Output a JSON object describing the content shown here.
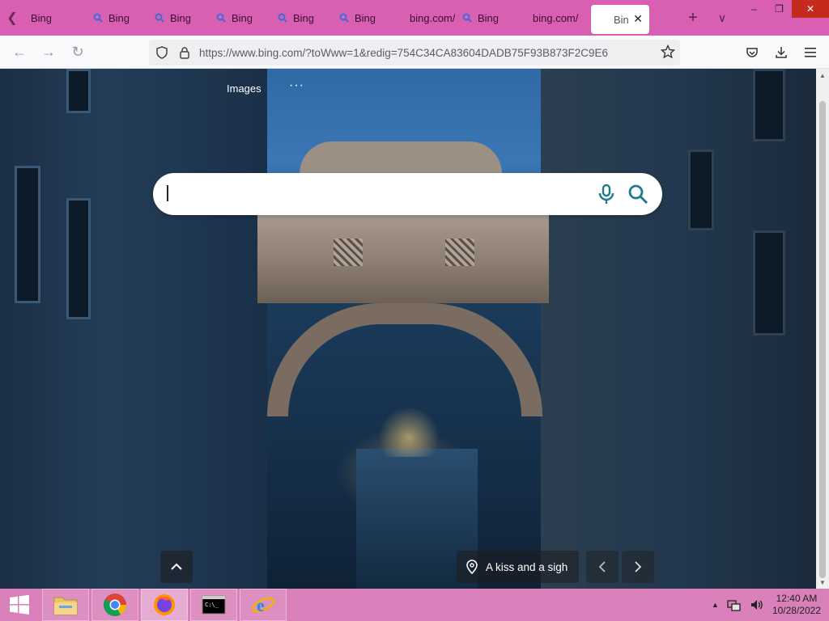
{
  "browser": {
    "tabs": [
      {
        "label": "Bing",
        "icon": "search-icon"
      },
      {
        "label": "Bing",
        "icon": "search-icon"
      },
      {
        "label": "Bing",
        "icon": "search-icon"
      },
      {
        "label": "Bing",
        "icon": "search-icon"
      },
      {
        "label": "Bing",
        "icon": "search-icon"
      },
      {
        "label": "Bing",
        "icon": "search-icon"
      },
      {
        "label": "bing.com/",
        "icon": ""
      },
      {
        "label": "Bing",
        "icon": "search-icon"
      },
      {
        "label": "bing.com/",
        "icon": ""
      },
      {
        "label": "Bin",
        "icon": "",
        "active": true
      }
    ],
    "url": "https://www.bing.com/?toWww=1&redig=754C34CA83604DADB75F93B873F2C9E6"
  },
  "bing": {
    "header_link": "Images",
    "more": "···",
    "search_value": "",
    "caption": "A kiss and a sigh"
  },
  "taskbar": {
    "apps": [
      "file-explorer",
      "chrome",
      "firefox",
      "command-prompt",
      "internet-explorer"
    ],
    "time": "12:40 AM",
    "date": "10/28/2022"
  },
  "colors": {
    "tabstrip": "#d95fb2",
    "taskbar": "#d980ba",
    "search_icon": "#1e7b8c"
  }
}
